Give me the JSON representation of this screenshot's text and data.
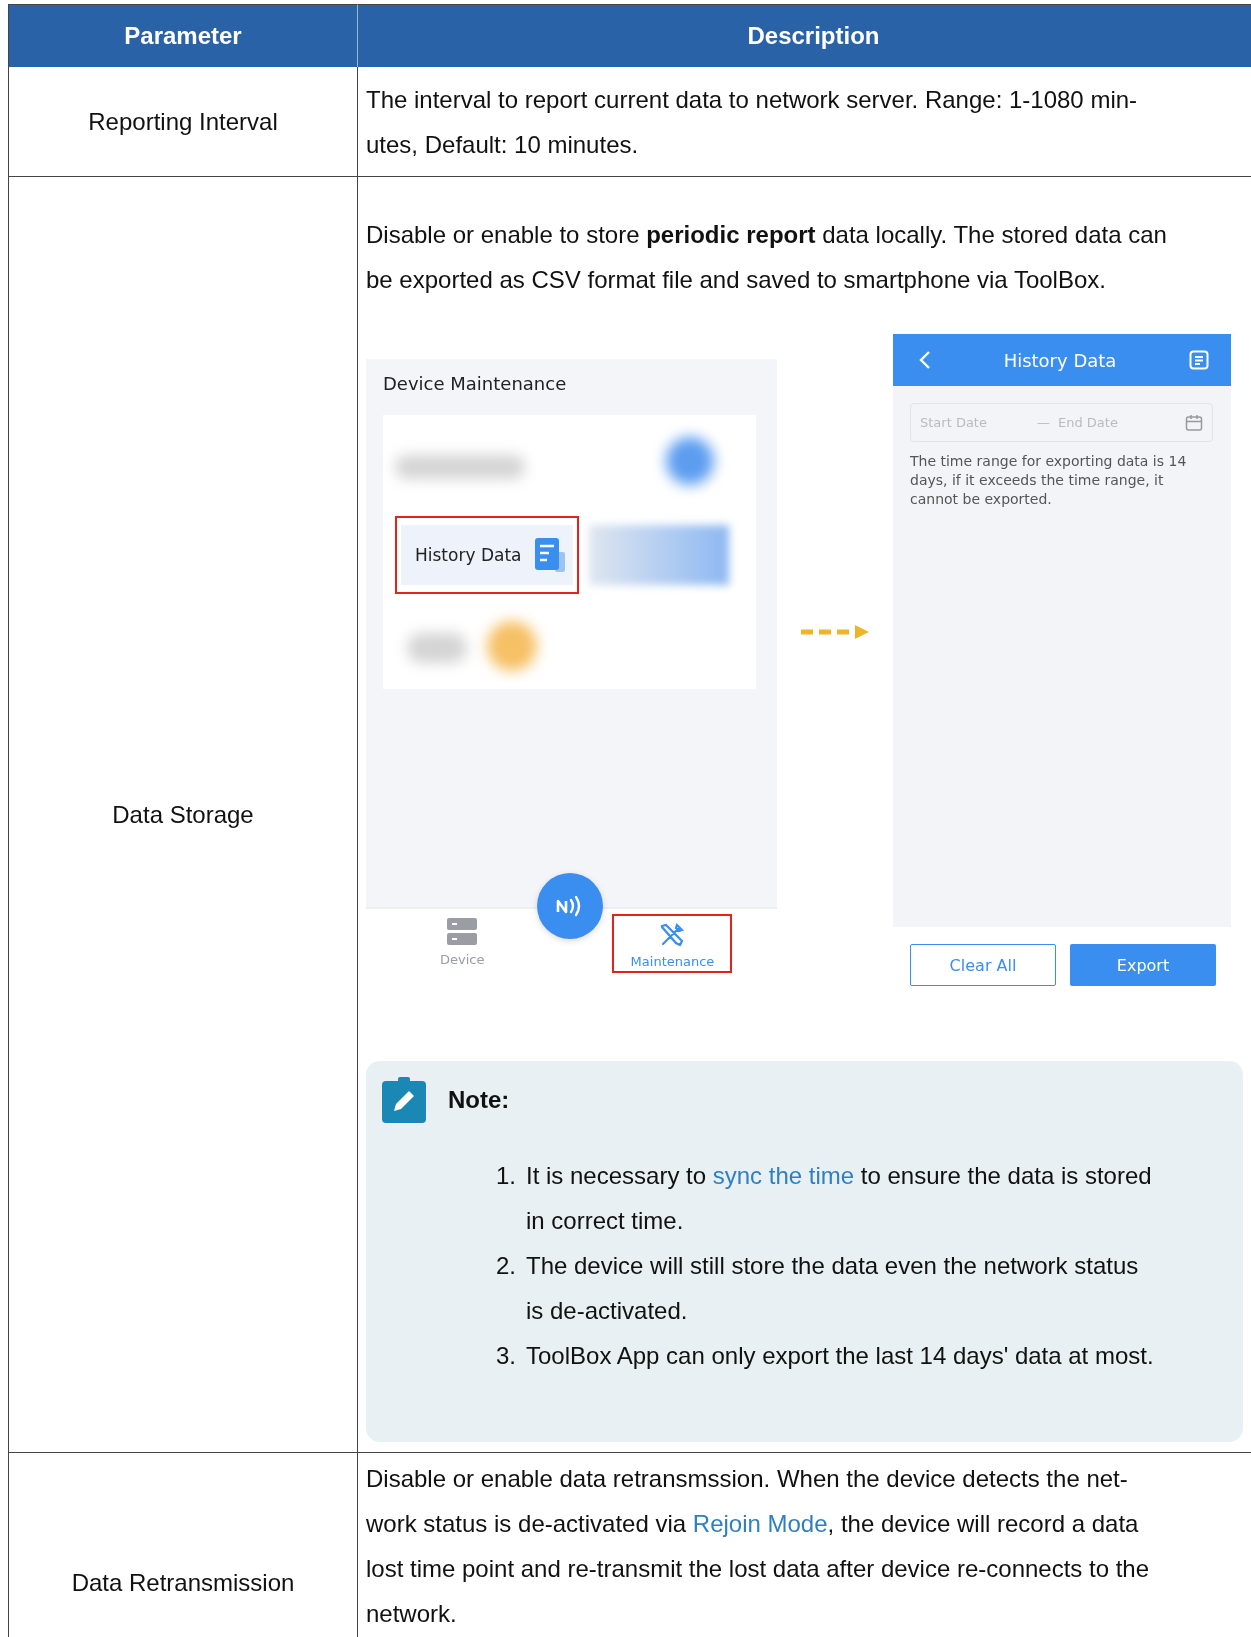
{
  "table": {
    "columns": [
      "Parameter",
      "Description"
    ],
    "rows": [
      {
        "parameter": "Reporting Interval",
        "description": [
          [
            {
              "text": "The interval to report current data to network server. Range: 1-1080 min-"
            }
          ],
          [
            {
              "text": "utes, Default: 10 minutes."
            }
          ]
        ]
      },
      {
        "parameter": "Data Storage",
        "description": [
          [
            {
              "text": "Disable or enable to store **periodic report** data locally. The stored data can"
            }
          ],
          [
            {
              "text": "be exported as CSV format file and saved to smartphone via ToolBox."
            }
          ]
        ],
        "figure": {
          "left_screen": {
            "title": "Device Maintenance",
            "tile": "History Data",
            "nav": [
              {
                "label": "Device",
                "selected": false
              },
              {
                "label": "Maintenance",
                "selected": true
              }
            ]
          },
          "right_screen": {
            "title": "History Data",
            "start_placeholder": "Start Date",
            "separator": "—",
            "end_placeholder": "End Date",
            "hint": "The time range for exporting data is 14 days, if it exceeds the time range, it cannot be exported.",
            "buttons": [
              "Clear All",
              "Export"
            ]
          }
        },
        "note": {
          "title": "Note:",
          "items": [
            {
              "number": "1.",
              "lines": [
                [
                  {
                    "text": "It is necessary to "
                  },
                  {
                    "text": "sync the time",
                    "kind": "link"
                  },
                  {
                    "text": " to ensure the data is stored"
                  }
                ],
                [
                  {
                    "text": "in correct time."
                  }
                ]
              ]
            },
            {
              "number": "2.",
              "lines": [
                [
                  {
                    "text": "The device will still store the data even the network status"
                  }
                ],
                [
                  {
                    "text": "is de-activated."
                  }
                ]
              ]
            },
            {
              "number": "3.",
              "lines": [
                [
                  {
                    "text": "ToolBox App can only export the last 14 days' data at most."
                  }
                ]
              ]
            }
          ]
        }
      },
      {
        "parameter": "Data Retransmission",
        "description": [
          [
            {
              "text": "Disable or enable data retransmssion. When the device detects the net-"
            }
          ],
          [
            {
              "text": "work status is de-activated via "
            },
            {
              "text": "Rejoin Mode",
              "kind": "link"
            },
            {
              "text": ", the device will record a data"
            }
          ],
          [
            {
              "text": "lost time point and re-transmit the lost data after device re-connects to the"
            }
          ],
          [
            {
              "text": "network."
            }
          ]
        ]
      }
    ]
  }
}
